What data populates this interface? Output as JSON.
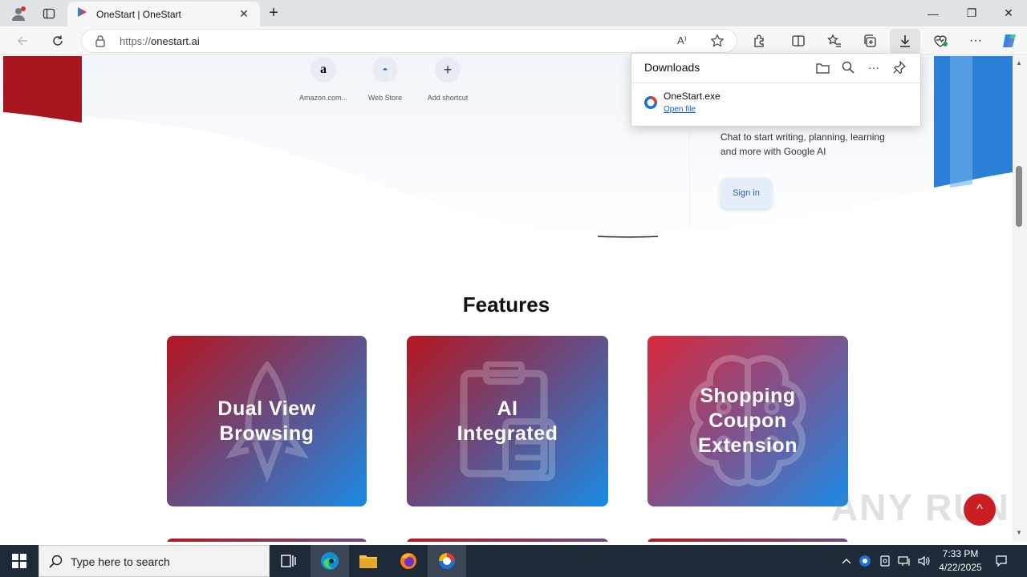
{
  "browser": {
    "tab_title": "OneStart | OneStart",
    "tab_close": "✕",
    "new_tab": "+",
    "window_controls": {
      "minimize": "—",
      "restore": "❐",
      "close": "✕"
    },
    "url_protocol": "https://",
    "url_host": "onestart.ai",
    "read_aloud_icon": "A⁾"
  },
  "page": {
    "shortcuts": [
      {
        "label": "Amazon.com...",
        "glyph": "a"
      },
      {
        "label": "Web Store",
        "glyph": "◓"
      },
      {
        "label": "Add shortcut",
        "glyph": "+"
      }
    ],
    "gemini_panel": {
      "text": "Chat to start writing, planning, learning and more with Google AI",
      "sign_in": "Sign in"
    },
    "features_title": "Features",
    "cards": [
      {
        "line1": "Dual View",
        "line2": "Browsing",
        "line3": ""
      },
      {
        "line1": "AI",
        "line2": "Integrated",
        "line3": ""
      },
      {
        "line1": "Shopping",
        "line2": "Coupon",
        "line3": "Extension"
      }
    ],
    "scroll_top_glyph": "^",
    "watermark": "ANY RUN"
  },
  "downloads": {
    "title": "Downloads",
    "file_name": "OneStart.exe",
    "open_file": "Open file"
  },
  "taskbar": {
    "search_placeholder": "Type here to search",
    "time": "7:33 PM",
    "date": "4/22/2025"
  },
  "colors": {
    "brand_red": "#c81e24",
    "card_gradient_start": "#b5161f",
    "card_gradient_end": "#1a8ae6",
    "accent_blue": "#2b7fd6"
  }
}
